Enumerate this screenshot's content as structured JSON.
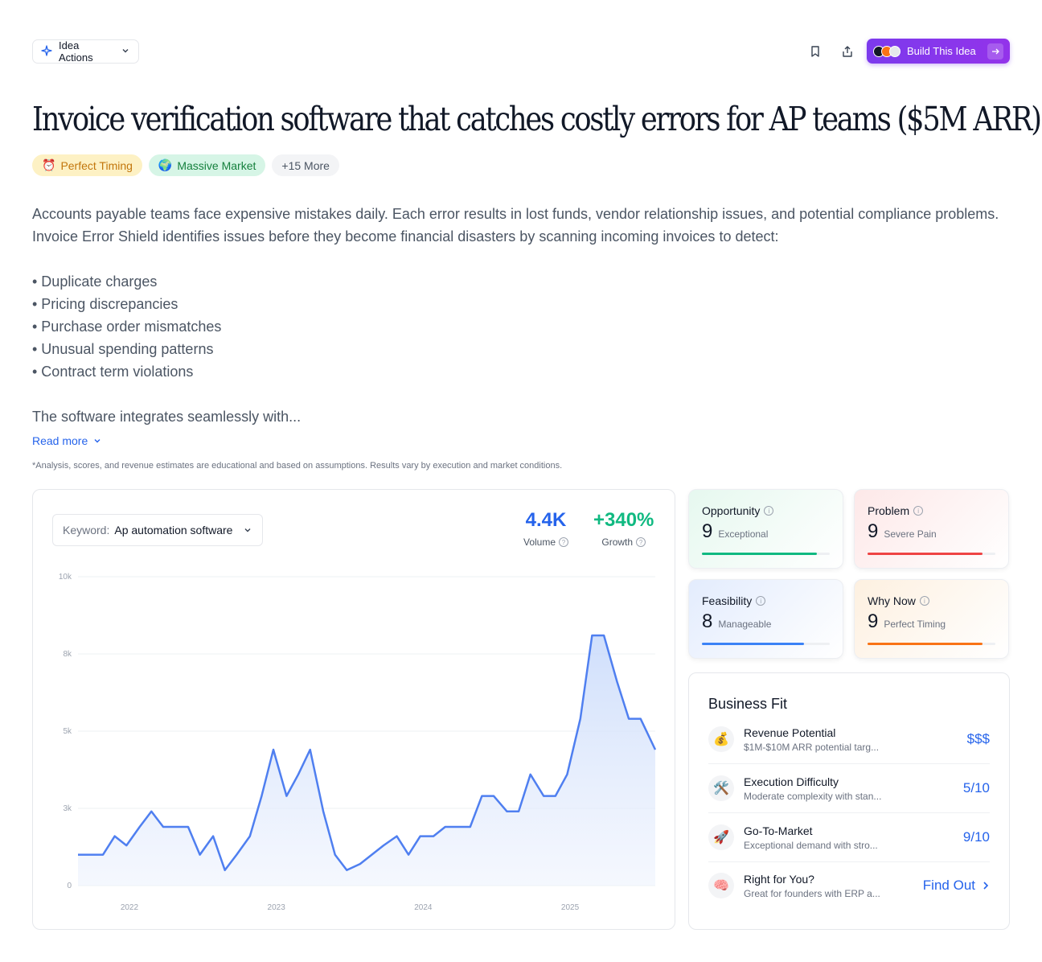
{
  "toolbar": {
    "idea_actions_label": "Idea Actions",
    "build_label": "Build This Idea",
    "avatar_colors": [
      "#111827",
      "#f97316",
      "#e5e7eb"
    ]
  },
  "title": "Invoice verification software that catches costly errors for AP teams ($5M ARR)",
  "tags": [
    {
      "emoji": "⏰",
      "label": "Perfect Timing"
    },
    {
      "emoji": "🌍",
      "label": "Massive Market"
    },
    {
      "label": "+15 More"
    }
  ],
  "description": {
    "intro": "Accounts payable teams face expensive mistakes daily. Each error results in lost funds, vendor relationship issues, and potential compliance problems. Invoice Error Shield identifies issues before they become financial disasters by scanning incoming invoices to detect:",
    "bullets": [
      "• Duplicate charges",
      "• Pricing discrepancies",
      "• Purchase order mismatches",
      "• Unusual spending patterns",
      "• Contract term violations"
    ],
    "tail": "The software integrates seamlessly with..."
  },
  "read_more": "Read more",
  "disclaimer": "*Analysis, scores, and revenue estimates are educational and based on assumptions. Results vary by execution and market conditions.",
  "keyword": {
    "label": "Keyword:",
    "value": "Ap automation software"
  },
  "stats": {
    "volume": {
      "value": "4.4K",
      "label": "Volume",
      "color": "#2563eb"
    },
    "growth": {
      "value": "+340%",
      "label": "Growth",
      "color": "#10b981"
    }
  },
  "chart_data": {
    "type": "area",
    "y_tick_labels": [
      "10k",
      "8k",
      "5k",
      "3k",
      "0"
    ],
    "y_tick_values": [
      10000,
      7500,
      5000,
      2500,
      0
    ],
    "x_tick_labels": [
      "2022",
      "2023",
      "2024",
      "2025"
    ],
    "ylim": [
      0,
      10000
    ],
    "xlim": [
      2021.65,
      2025.58
    ],
    "grid": true,
    "color": "#4f7ff0",
    "series": [
      {
        "points": [
          [
            2021.65,
            1000
          ],
          [
            2021.73,
            1000
          ],
          [
            2021.82,
            1000
          ],
          [
            2021.9,
            1600
          ],
          [
            2021.98,
            1300
          ],
          [
            2022.07,
            1900
          ],
          [
            2022.15,
            2400
          ],
          [
            2022.23,
            1900
          ],
          [
            2022.32,
            1900
          ],
          [
            2022.4,
            1900
          ],
          [
            2022.48,
            1000
          ],
          [
            2022.57,
            1600
          ],
          [
            2022.65,
            500
          ],
          [
            2022.73,
            1000
          ],
          [
            2022.82,
            1600
          ],
          [
            2022.9,
            2900
          ],
          [
            2022.98,
            4400
          ],
          [
            2023.07,
            2900
          ],
          [
            2023.15,
            3600
          ],
          [
            2023.23,
            4400
          ],
          [
            2023.32,
            2400
          ],
          [
            2023.4,
            1000
          ],
          [
            2023.48,
            500
          ],
          [
            2023.57,
            700
          ],
          [
            2023.65,
            1000
          ],
          [
            2023.73,
            1300
          ],
          [
            2023.82,
            1600
          ],
          [
            2023.9,
            1000
          ],
          [
            2023.98,
            1600
          ],
          [
            2024.07,
            1600
          ],
          [
            2024.15,
            1900
          ],
          [
            2024.23,
            1900
          ],
          [
            2024.32,
            1900
          ],
          [
            2024.4,
            2900
          ],
          [
            2024.48,
            2900
          ],
          [
            2024.57,
            2400
          ],
          [
            2024.65,
            2400
          ],
          [
            2024.73,
            3600
          ],
          [
            2024.82,
            2900
          ],
          [
            2024.9,
            2900
          ],
          [
            2024.98,
            3600
          ],
          [
            2025.07,
            5400
          ],
          [
            2025.15,
            8100
          ],
          [
            2025.23,
            8100
          ],
          [
            2025.32,
            6600
          ],
          [
            2025.4,
            5400
          ],
          [
            2025.48,
            5400
          ],
          [
            2025.58,
            4400
          ]
        ]
      }
    ]
  },
  "scores": [
    {
      "title": "Opportunity",
      "score": "9",
      "label": "Exceptional",
      "value": 0.9,
      "color": "#10b981",
      "bg": "linear-gradient(135deg,#e6f8ef,#ffffff)"
    },
    {
      "title": "Problem",
      "score": "9",
      "label": "Severe Pain",
      "value": 0.9,
      "color": "#ef4444",
      "bg": "linear-gradient(135deg,#fde8e8,#ffffff)"
    },
    {
      "title": "Feasibility",
      "score": "8",
      "label": "Manageable",
      "value": 0.8,
      "color": "#3b82f6",
      "bg": "linear-gradient(135deg,#e3ecfd,#ffffff)"
    },
    {
      "title": "Why Now",
      "score": "9",
      "label": "Perfect Timing",
      "value": 0.9,
      "color": "#f97316",
      "bg": "linear-gradient(135deg,#fdf0e0,#ffffff)"
    }
  ],
  "business_fit": {
    "title": "Business Fit",
    "rows": [
      {
        "icon": "💰",
        "title": "Revenue Potential",
        "sub": "$1M-$10M ARR potential targ...",
        "value": "$$$"
      },
      {
        "icon": "🛠️",
        "title": "Execution Difficulty",
        "sub": "Moderate complexity with stan...",
        "value": "5/10"
      },
      {
        "icon": "🚀",
        "title": "Go-To-Market",
        "sub": "Exceptional demand with stro...",
        "value": "9/10"
      },
      {
        "icon": "🧠",
        "title": "Right for You?",
        "sub": "Great for founders with ERP a...",
        "value": "Find Out"
      }
    ]
  }
}
